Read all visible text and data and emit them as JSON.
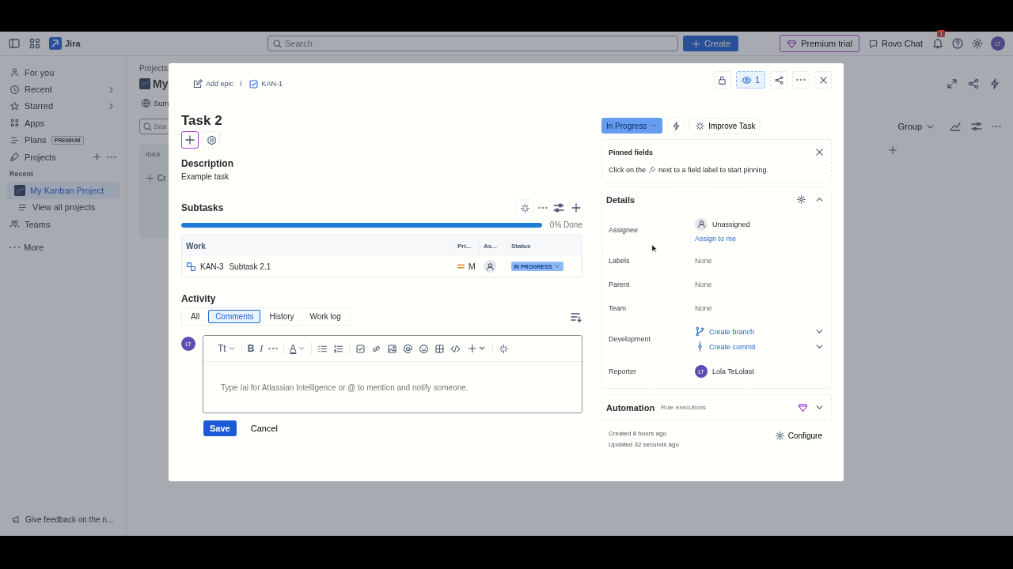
{
  "topbar": {
    "product": "Jira",
    "search": {
      "placeholder": "Search"
    },
    "create": "Create",
    "premium": "Premium trial",
    "rovo": "Rovo Chat",
    "notifications": "1",
    "avatar": "LT"
  },
  "sidebar": {
    "items": [
      {
        "kind": "item",
        "label": "For you",
        "expandable": false,
        "selected": false
      },
      {
        "kind": "item",
        "label": "Recent",
        "expandable": true,
        "selected": false
      },
      {
        "kind": "item",
        "label": "Starred",
        "expandable": true,
        "selected": false
      },
      {
        "kind": "item",
        "label": "Apps",
        "expandable": false,
        "selected": false
      },
      {
        "kind": "item",
        "label": "Plans",
        "badge": "PREMIUM",
        "expandable": false,
        "selected": false
      },
      {
        "kind": "section",
        "label": "Projects",
        "expandable": false,
        "selected": false
      },
      {
        "kind": "heading",
        "label": "Recent"
      },
      {
        "kind": "project",
        "label": "My Kanban Project",
        "expandable": false,
        "selected": true
      },
      {
        "kind": "sub",
        "label": "View all projects",
        "expandable": false,
        "selected": false
      },
      {
        "kind": "item",
        "label": "Teams",
        "expandable": false,
        "selected": false
      },
      {
        "kind": "item",
        "label": "More",
        "expandable": false,
        "selected": false
      }
    ],
    "feedback": "Give feedback on the n..."
  },
  "board": {
    "breadcrumb": "Projects",
    "title": "My",
    "tab": "Sum",
    "search": {
      "placeholder": "Sea"
    },
    "column": "IDEA",
    "create": "Cr",
    "group": "Group"
  },
  "modal": {
    "breadcrumb": {
      "epic": "Add epic",
      "separator": "/",
      "parent": "KAN-1"
    },
    "watchers": "1",
    "title": "Task 2",
    "description": {
      "heading": "Description",
      "text": "Example task"
    },
    "subtasks": {
      "heading": "Subtasks",
      "progress": {
        "level": 1,
        "reading": "0% Done"
      },
      "columns": [
        "Work",
        "Pri...",
        "As...",
        "Status"
      ],
      "rows": [
        {
          "key": "KAN-3",
          "summary": "Subtask 2.1",
          "priority": "M",
          "status": "IN PROGRESS"
        }
      ]
    },
    "activity": {
      "heading": "Activity",
      "tabs": [
        {
          "label": "All",
          "selected": false
        },
        {
          "label": "Comments",
          "selected": true
        },
        {
          "label": "History",
          "selected": false
        },
        {
          "label": "Work log",
          "selected": false
        }
      ]
    },
    "editor": {
      "avatar": "LT",
      "format": [
        "Tt",
        "B",
        "I",
        "A"
      ],
      "placeholder": "Type /ai for Atlassian Intelligence or @ to mention and notify someone."
    },
    "buttons": [
      "Save",
      "Cancel"
    ],
    "status": "In Progress",
    "improve": "Improve Task",
    "pinned": {
      "title": "Pinned fields",
      "hint_before": "Click on the",
      "hint_after": "next to a field label to start pinning."
    },
    "details": {
      "heading": "Details",
      "fields": [
        {
          "label": "Assignee",
          "kind": "user",
          "value": "Unassigned",
          "action": "Assign to me"
        },
        {
          "label": "Labels",
          "kind": "text",
          "value": "None"
        },
        {
          "label": "Parent",
          "kind": "text",
          "value": "None"
        },
        {
          "label": "Team",
          "kind": "text",
          "value": "None"
        },
        {
          "label": "Development",
          "kind": "links",
          "links": [
            "Create branch",
            "Create commit"
          ]
        },
        {
          "label": "Reporter",
          "kind": "avatar",
          "initials": "LT",
          "value": "Lola TeLolast"
        }
      ]
    },
    "automation": {
      "heading": "Automation",
      "sub": "Rule executions"
    },
    "meta": {
      "created": "Created 8 hours ago",
      "updated": "Updated 32 seconds ago",
      "configure": "Configure"
    }
  }
}
